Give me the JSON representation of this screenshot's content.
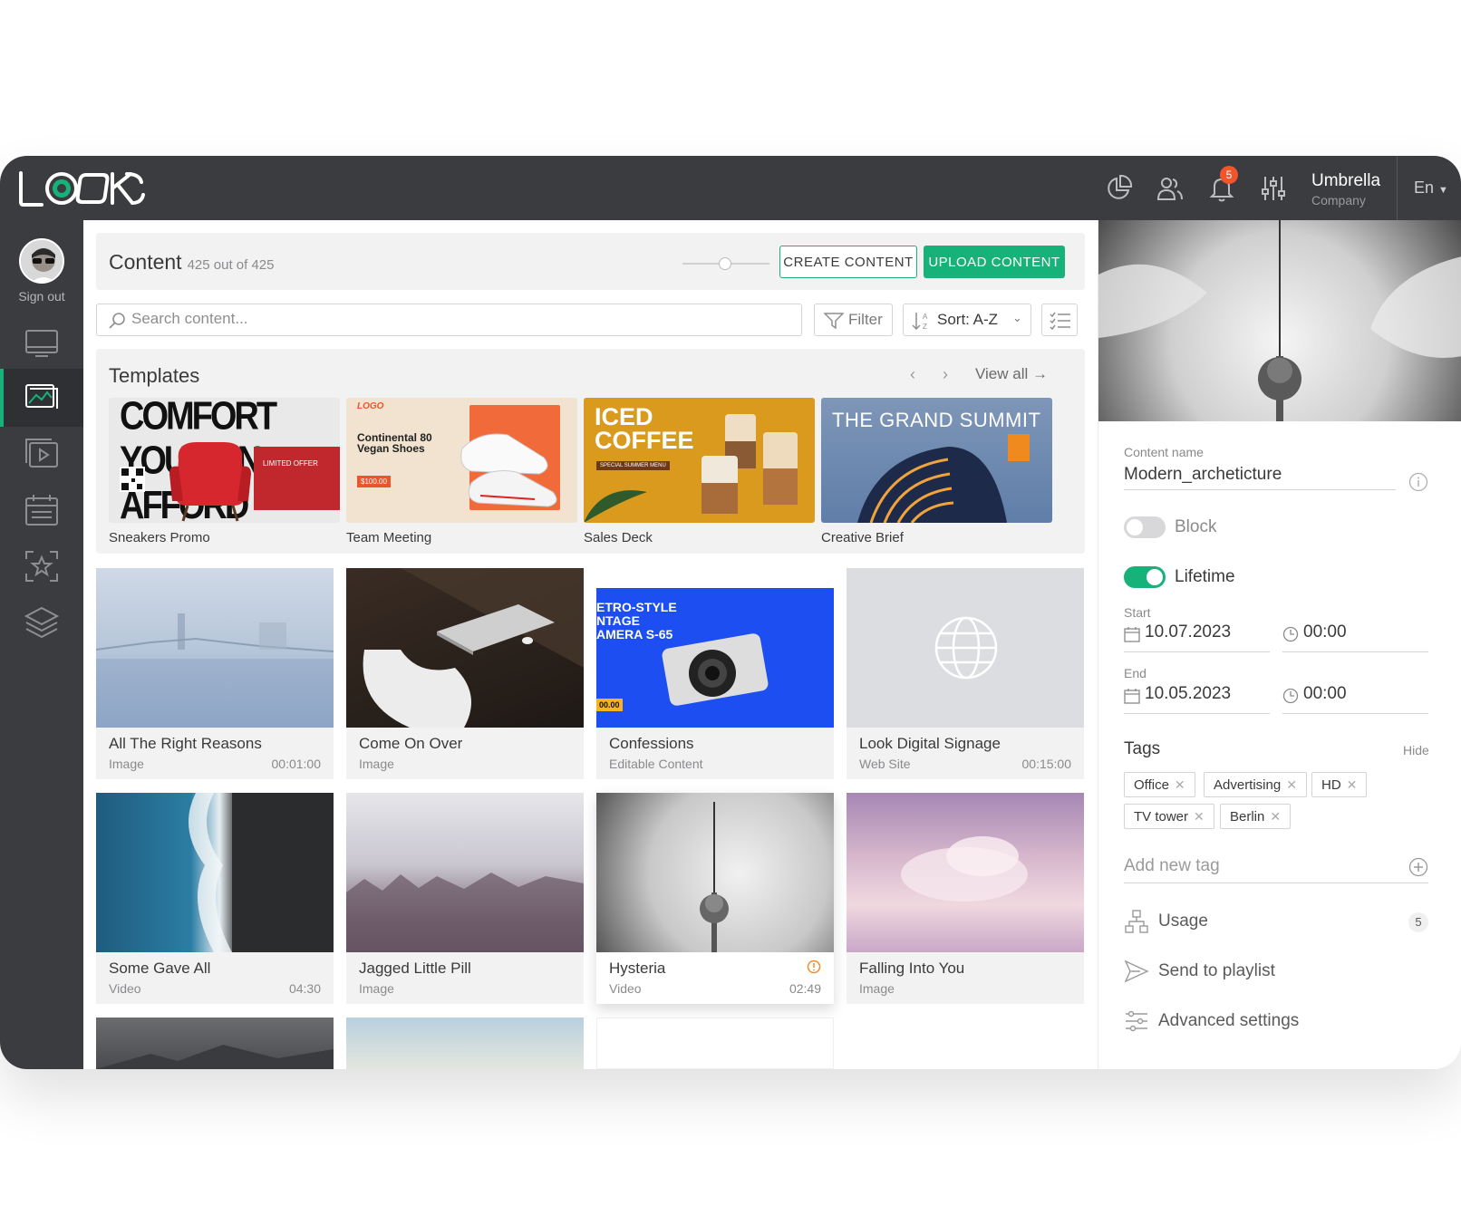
{
  "topbar": {
    "company_name": "Umbrella",
    "company_sub": "Company",
    "notif_count": "5",
    "lang": "En"
  },
  "sidebar": {
    "signout": "Sign out",
    "items": [
      "monitor-icon",
      "content-icon",
      "playlist-icon",
      "schedule-icon",
      "widgets-icon",
      "layers-icon"
    ],
    "active_index": 1
  },
  "content": {
    "title": "Content",
    "count": "425 out of 425",
    "create_btn": "CREATE CONTENT",
    "upload_btn": "UPLOAD CONTENT",
    "search_placeholder": "Search content...",
    "filter": "Filter",
    "sort": "Sort: A-Z"
  },
  "templates": {
    "title": "Templates",
    "view_all": "View all",
    "items": [
      {
        "label": "Sneakers Promo",
        "art": "COMFORT YOU CAN AFFORD",
        "badge": "LIMITED OFFER"
      },
      {
        "label": "Team Meeting",
        "art": "Continental 80 Vegan Shoes",
        "logo": "LOGO",
        "price": "$100.00"
      },
      {
        "label": "Sales Deck",
        "art_l1": "ICED",
        "art_l2": "COFFEE",
        "sub": "SPECIAL SUMMER MENU"
      },
      {
        "label": "Creative Brief",
        "art": "THE GRAND SUMMIT"
      }
    ]
  },
  "cards": [
    {
      "name": "All The Right Reasons",
      "type": "Image",
      "dur": "00:01:00"
    },
    {
      "name": "Come On Over",
      "type": "Image",
      "dur": ""
    },
    {
      "name": "Confessions",
      "type": "Editable Content",
      "dur": "",
      "art": "ETRO-STYLE NTAGE AMERA S-65",
      "price": "00.00"
    },
    {
      "name": "Look Digital Signage",
      "type": "Web Site",
      "dur": "00:15:00"
    },
    {
      "name": "Some Gave All",
      "type": "Video",
      "dur": "04:30"
    },
    {
      "name": "Jagged Little Pill",
      "type": "Image",
      "dur": ""
    },
    {
      "name": "Hysteria",
      "type": "Video",
      "dur": "02:49"
    },
    {
      "name": "Falling Into You",
      "type": "Image",
      "dur": ""
    }
  ],
  "panel": {
    "name_label": "Content name",
    "name_value": "Modern_archeticture",
    "block_label": "Block",
    "block_on": false,
    "lifetime_label": "Lifetime",
    "lifetime_on": true,
    "start_label": "Start",
    "start_date": "10.07.2023",
    "start_time": "00:00",
    "end_label": "End",
    "end_date": "10.05.2023",
    "end_time": "00:00",
    "tags_label": "Tags",
    "hide": "Hide",
    "tags": [
      "Office",
      "Advertising",
      "HD",
      "TV tower",
      "Berlin"
    ],
    "add_tag": "Add new tag",
    "usage": "Usage",
    "usage_count": "5",
    "send": "Send to playlist",
    "advanced": "Advanced settings"
  },
  "colors": {
    "accent": "#16b27a",
    "topbar": "#3b3c3f",
    "badge": "#f2552c"
  }
}
